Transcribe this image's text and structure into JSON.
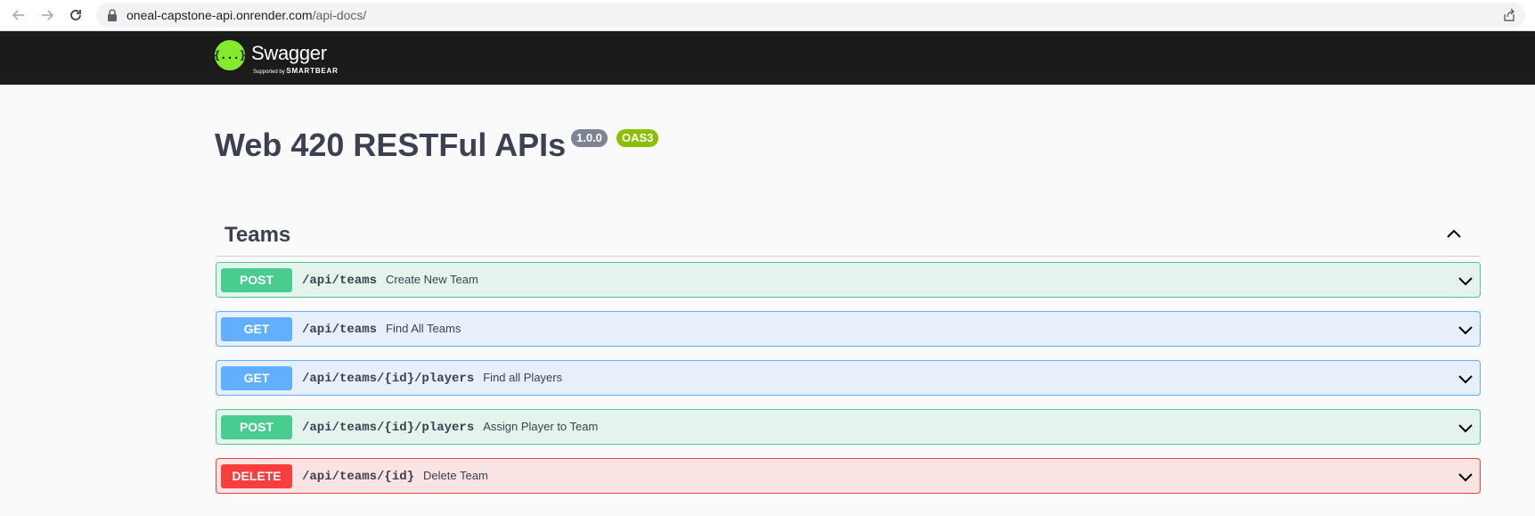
{
  "browser": {
    "url_host": "oneal-capstone-api.onrender.com",
    "url_path": "/api-docs/",
    "icons": [
      "back-arrow-icon",
      "forward-arrow-icon",
      "reload-icon",
      "lock-icon",
      "share-icon"
    ]
  },
  "topbar": {
    "logo_title": "Swagger",
    "logo_supported": "Supported by",
    "logo_brand": "SMARTBEAR",
    "logo_symbol": "{...}",
    "logo_color": "#85ea2d",
    "background": "#1b1b1b"
  },
  "info": {
    "title": "Web 420 RESTFul APIs",
    "version": "1.0.0",
    "oas": "OAS3"
  },
  "tag": {
    "name": "Teams",
    "expanded": true
  },
  "operations": [
    {
      "method": "POST",
      "path": "/api/teams",
      "summary": "Create New Team"
    },
    {
      "method": "GET",
      "path": "/api/teams",
      "summary": "Find All Teams"
    },
    {
      "method": "GET",
      "path": "/api/teams/{id}/players",
      "summary": "Find all Players"
    },
    {
      "method": "POST",
      "path": "/api/teams/{id}/players",
      "summary": "Assign Player to Team"
    },
    {
      "method": "DELETE",
      "path": "/api/teams/{id}",
      "summary": "Delete Team"
    }
  ],
  "colors": {
    "post": "#49cc90",
    "get": "#61affe",
    "delete": "#f93e3e",
    "text": "#3b4151"
  }
}
